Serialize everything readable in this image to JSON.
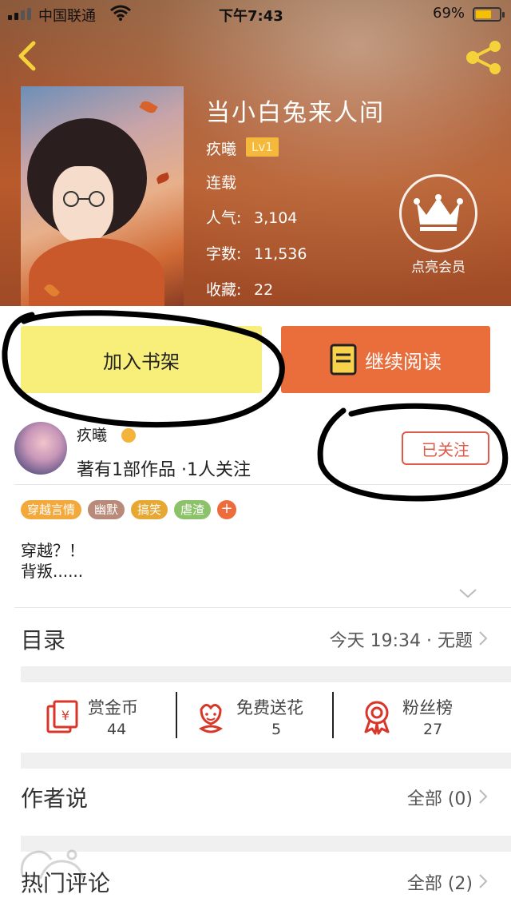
{
  "status_bar": {
    "carrier": "中国联通",
    "time": "下午7:43",
    "battery_pct": "69%",
    "battery_level": 0.69
  },
  "book": {
    "title": "当小白兔来人间",
    "author": "疚曦",
    "author_level": "Lv1",
    "status": "连载",
    "popularity_label": "人气:",
    "popularity": "3,104",
    "words_label": "字数:",
    "words": "11,536",
    "favorites_label": "收藏:",
    "favorites": "22"
  },
  "vip": {
    "label": "点亮会员"
  },
  "buttons": {
    "add_shelf": "加入书架",
    "continue_read": "继续阅读"
  },
  "author_row": {
    "name": "疚曦",
    "works_info": "著有1部作品 ·1人关注",
    "follow": "已关注"
  },
  "tags": [
    {
      "label": "穿越言情",
      "color": "#f2a83a"
    },
    {
      "label": "幽默",
      "color": "#b98a7a"
    },
    {
      "label": "搞笑",
      "color": "#e6a832"
    },
    {
      "label": "虐渣",
      "color": "#8cc26a"
    },
    {
      "label": "+",
      "color": "#ee6b3c"
    }
  ],
  "description": {
    "line1": "穿越？！",
    "line2": "背叛......"
  },
  "catalog": {
    "title": "目录",
    "latest": "今天 19:34 · 无题"
  },
  "stats": [
    {
      "label": "赏金币",
      "value": "44"
    },
    {
      "label": "免费送花",
      "value": "5"
    },
    {
      "label": "粉丝榜",
      "value": "27"
    }
  ],
  "author_says": {
    "title": "作者说",
    "count": "全部 (0)"
  },
  "hot_comments": {
    "title": "热门评论",
    "count": "全部 (2)"
  },
  "colors": {
    "accent": "#ea6e3c",
    "shelf_button": "#f8ef7a",
    "follow_red": "#e05a4a",
    "stat_icon_red": "#d9362a"
  }
}
